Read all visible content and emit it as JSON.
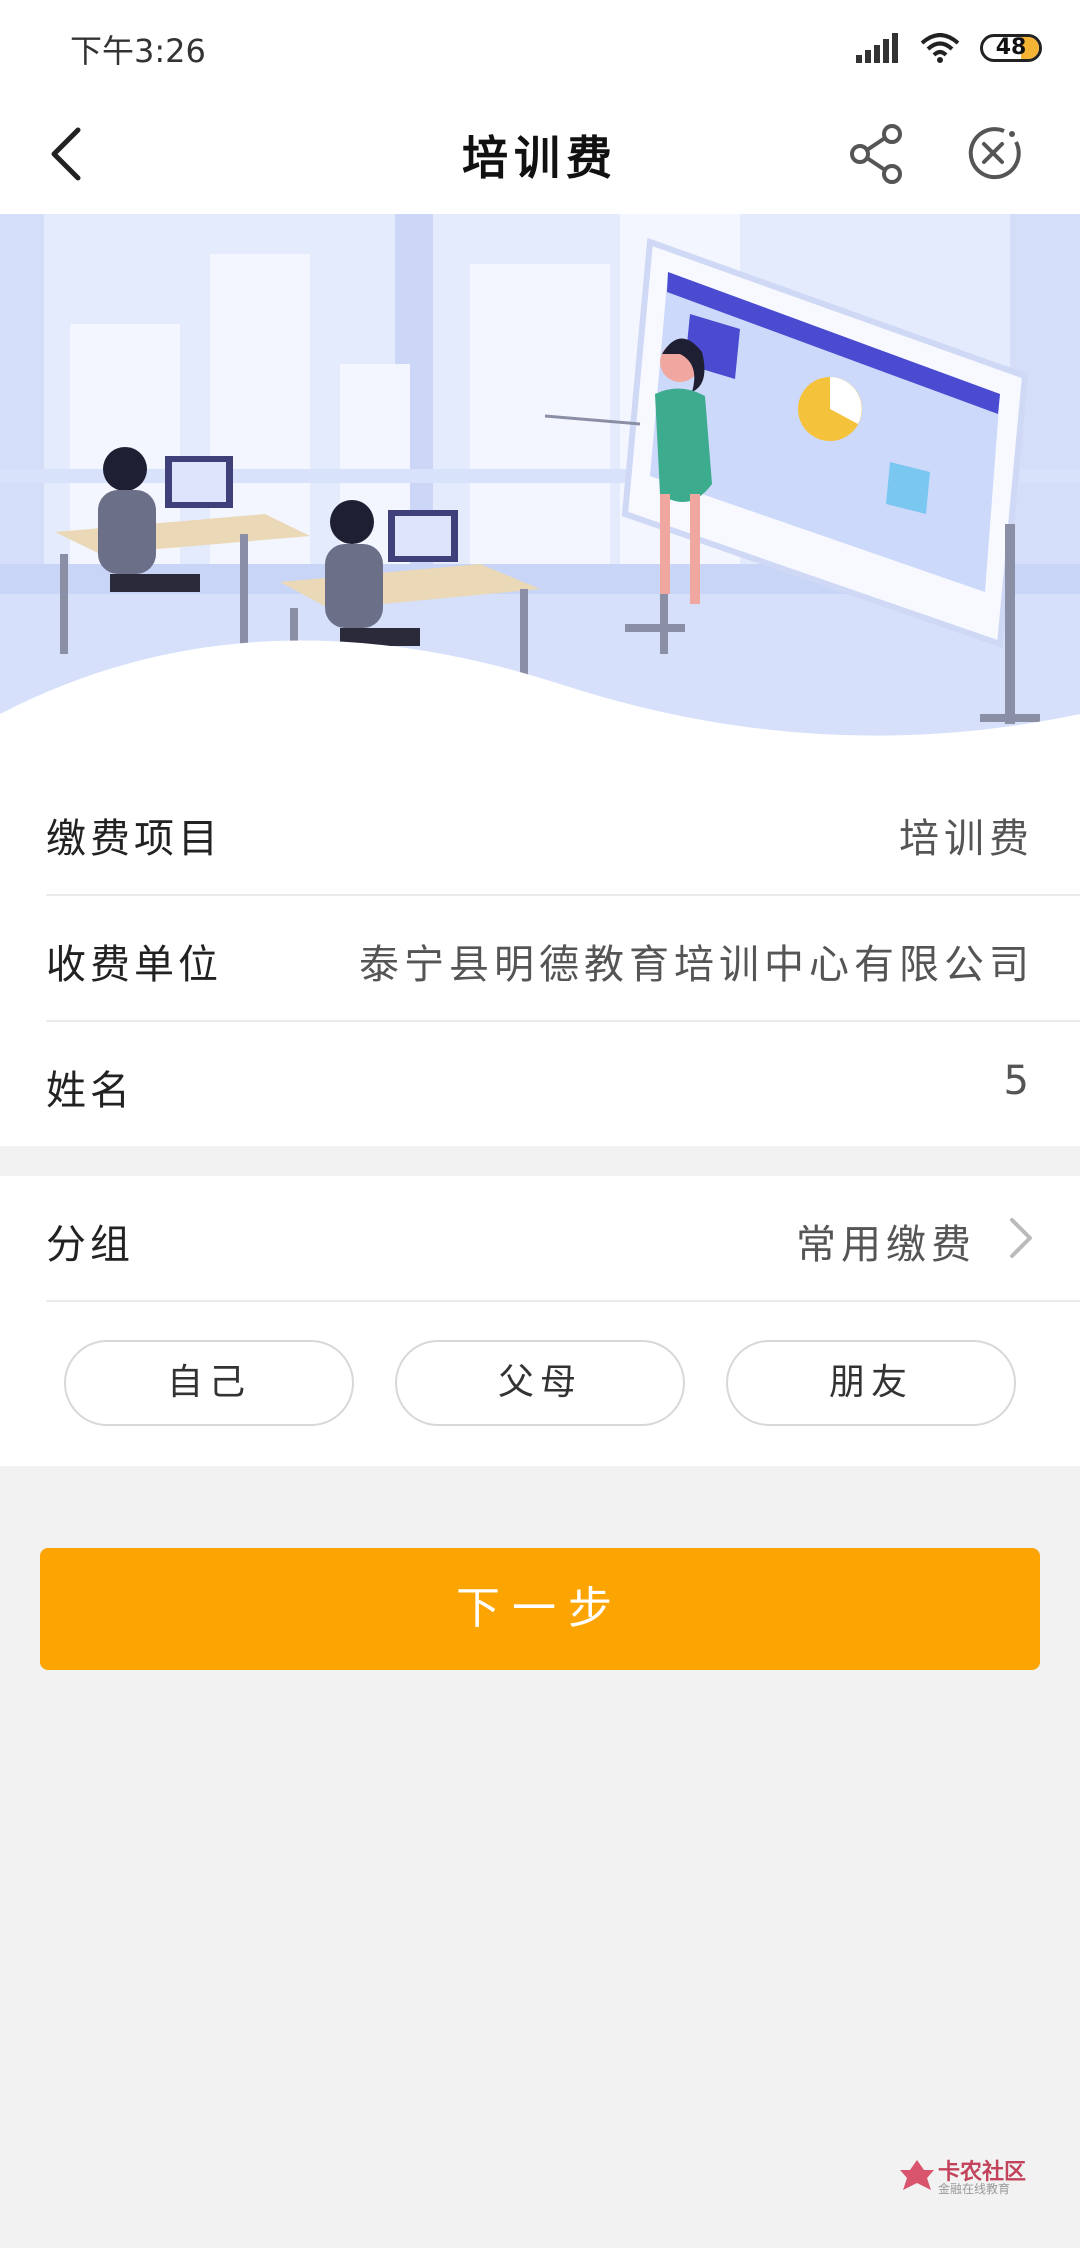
{
  "status_bar": {
    "time": "下午3:26",
    "battery": "48",
    "signal_icon": "signal-bars-icon",
    "wifi_icon": "wifi-icon"
  },
  "navbar": {
    "title": "培训费",
    "back_icon": "chevron-left-icon",
    "share_icon": "share-icon",
    "close_icon": "close-circle-icon"
  },
  "banner": {
    "illustration": "training-classroom-illustration"
  },
  "info_rows": [
    {
      "label": "缴费项目",
      "value": "培训费"
    },
    {
      "label": "收费单位",
      "value": "泰宁县明德教育培训中心有限公司"
    },
    {
      "label": "姓名",
      "value": "5"
    }
  ],
  "group": {
    "label": "分组",
    "value": "常用缴费",
    "options": [
      "自己",
      "父母",
      "朋友"
    ]
  },
  "next_button": {
    "label": "下一步"
  },
  "watermark": {
    "title": "卡农社区",
    "subtitle": "金融在线教育"
  },
  "colors": {
    "accent": "#fca402",
    "background": "#f2f2f2",
    "banner_blue": "#cfd9f7",
    "watermark_red": "#c2435b"
  }
}
